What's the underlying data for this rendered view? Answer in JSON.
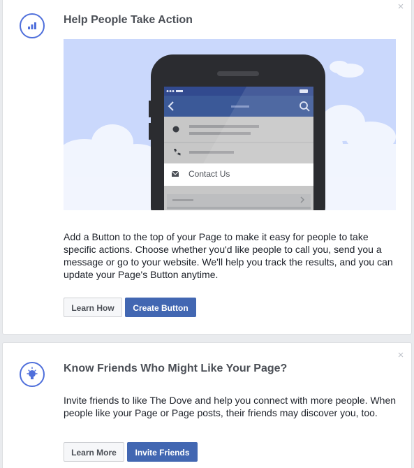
{
  "card_action": {
    "title": "Help People Take Action",
    "description": "Add a Button to the top of your Page to make it easy for people to take specific actions. Choose whether you'd like people to call you, send you a message or go to your website. We'll help you track the results, and you can update your Page's Button anytime.",
    "illustration": {
      "contact_label": "Contact Us"
    },
    "learn_label": "Learn How",
    "primary_label": "Create Button",
    "close_glyph": "×",
    "icon": "bar-chart-icon"
  },
  "card_friends": {
    "title": "Know Friends Who Might Like Your Page?",
    "description": "Invite friends to like The Dove and help you connect with more people. When people like your Page or Page posts, their friends may discover you, too.",
    "learn_label": "Learn More",
    "primary_label": "Invite Friends",
    "close_glyph": "×",
    "icon": "lightbulb-icon"
  },
  "colors": {
    "accent": "#4267b2",
    "icon_blue": "#4f6fdb",
    "illustration_bg": "#cad8fc"
  }
}
